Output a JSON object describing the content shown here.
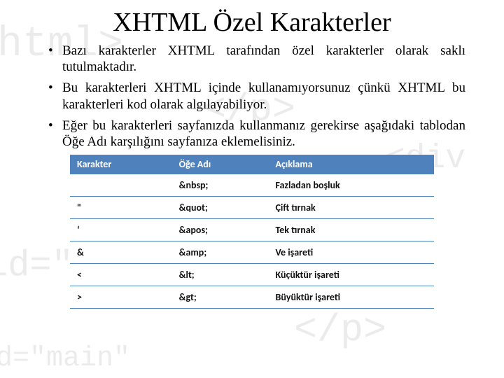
{
  "title": "XHTML Özel Karakterler",
  "bullets": [
    "Bazı karakterler XHTML tarafından özel karakterler olarak saklı tutulmaktadır.",
    "Bu karakterleri XHTML içinde kullanamıyorsunuz çünkü XHTML bu karakterleri kod olarak algılayabiliyor.",
    "Eğer bu karakterleri sayfanızda kullanmanız gerekirse aşağıdaki tablodan Öğe Adı karşılığını sayfanıza eklemelisiniz."
  ],
  "table": {
    "headers": [
      "Karakter",
      "Öğe Adı",
      "Açıklama"
    ],
    "rows": [
      [
        "",
        "&nbsp;",
        "Fazladan boşluk"
      ],
      [
        "\"",
        "&quot;",
        "Çift tırnak"
      ],
      [
        "‘",
        "&apos;",
        "Tek tırnak"
      ],
      [
        "&",
        "&amp;",
        "Ve işareti"
      ],
      [
        "<",
        "&lt;",
        "Küçüktür işareti"
      ],
      [
        ">",
        "&gt;",
        "Büyüktür işareti"
      ]
    ]
  },
  "watermarks": [
    "<html>",
    "</p>",
    "<html>",
    "id=\"main\"",
    "</p>",
    "id=\"main\"",
    "<div"
  ]
}
